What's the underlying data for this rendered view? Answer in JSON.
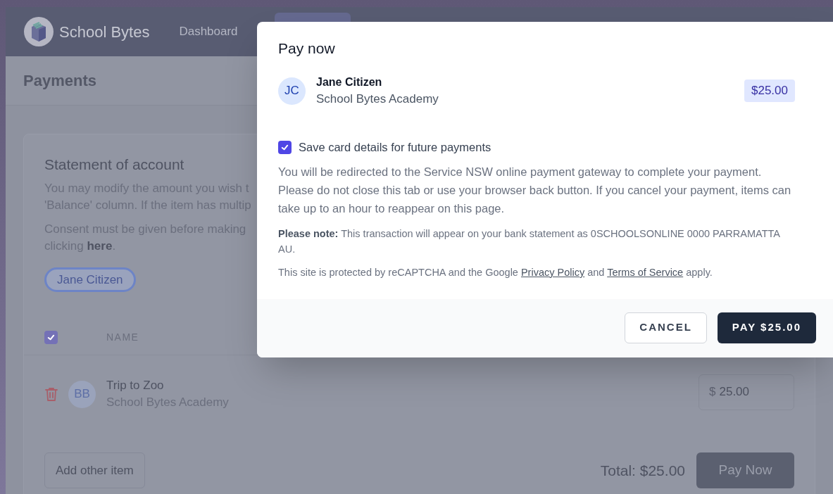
{
  "nav": {
    "brand": "School Bytes",
    "links": [
      {
        "label": "Dashboard",
        "selected": false
      }
    ]
  },
  "page": {
    "title": "Payments"
  },
  "statement": {
    "heading": "Statement of account",
    "intro_lines": [
      "You may modify the amount you wish t",
      "'Balance' column. If the item has multip"
    ],
    "consent_lines": [
      "Consent must be given before making",
      "clicking **here**."
    ],
    "students": [
      {
        "label": "Jane Citizen",
        "selected": true
      }
    ],
    "table": {
      "select_all_checked": true,
      "columns": [
        "NAME"
      ],
      "rows": [
        {
          "initials": "BB",
          "title": "Trip to Zoo",
          "subtitle": "School Bytes Academy",
          "currency": "$",
          "amount": "25.00"
        }
      ]
    },
    "add_button": "Add other item",
    "total": "Total: $25.00",
    "pay_button": {
      "label": "Pay Now",
      "disabled": true
    }
  },
  "modal": {
    "title": "Pay now",
    "payer": {
      "initials": "JC",
      "name": "Jane Citizen",
      "organisation": "School Bytes Academy",
      "amount": "$25.00"
    },
    "save_card": {
      "label": "Save card details for future payments",
      "checked": true
    },
    "redirect_text": "You will be redirected to the Service NSW online payment gateway to complete your payment. Please do not close this tab or use your browser back button. If you cancel your payment, items can take up to an hour to reappear on this page.",
    "note_text": "**Please note:** This transaction will appear on your bank statement as 0SCHOOLSONLINE 0000 PARRAMATTA AU.",
    "recaptcha": {
      "before": "This site is protected by reCAPTCHA and the Google",
      "link1": "Privacy Policy",
      "middle": "and",
      "link2": "Terms of Service",
      "after": "apply."
    },
    "buttons": [
      {
        "kind": "secondary",
        "label": "CANCEL"
      },
      {
        "kind": "primary",
        "label": "PAY $25.00"
      }
    ]
  }
}
